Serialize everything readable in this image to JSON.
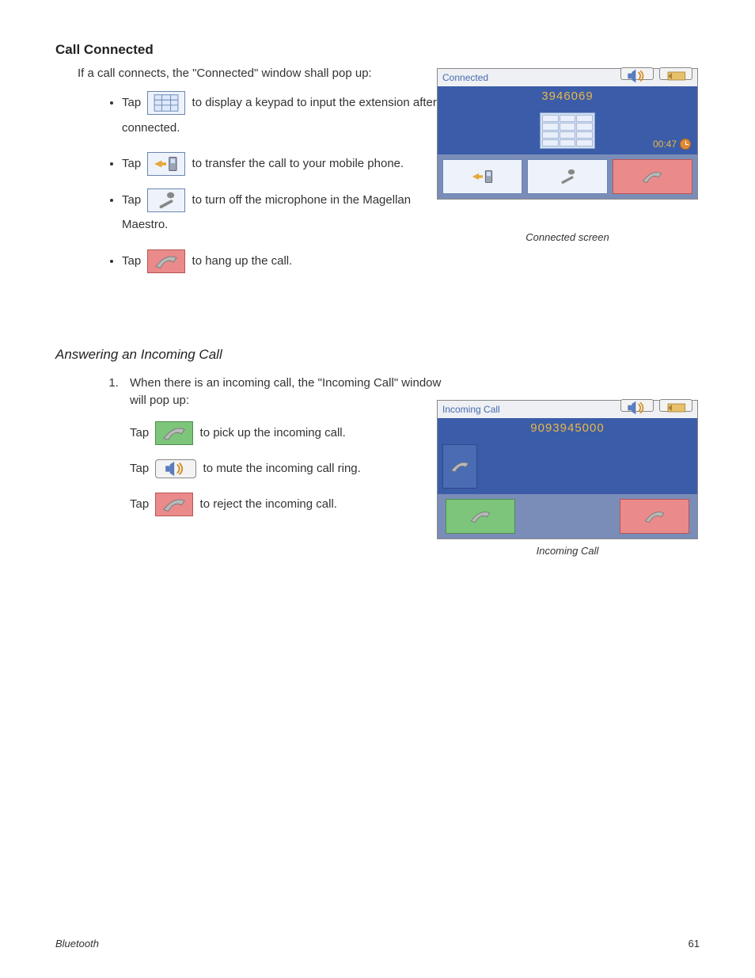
{
  "section1": {
    "title": "Call Connected",
    "intro": "If a call connects, the \"Connected\" window shall pop up:",
    "bullets": [
      {
        "pre": "Tap",
        "post": "to display a keypad to input the extension after connected."
      },
      {
        "pre": "Tap",
        "post": "to transfer the call to your mobile phone."
      },
      {
        "pre": "Tap",
        "post": "to turn off the microphone in the Magellan Maestro."
      },
      {
        "pre": "Tap",
        "post": "to hang up the call."
      }
    ],
    "screenshot": {
      "title": "Connected",
      "number": "3946069",
      "timer": "00:47",
      "caption": "Connected screen"
    }
  },
  "section2": {
    "title": "Answering an Incoming Call",
    "item1": "When there is an incoming call, the \"Incoming Call\" window will pop up:",
    "lines": [
      {
        "pre": "Tap",
        "post": "to pick up the incoming call."
      },
      {
        "pre": "Tap",
        "post": "to mute the incoming call ring."
      },
      {
        "pre": "Tap",
        "post": "to reject the incoming call."
      }
    ],
    "screenshot": {
      "title": "Incoming Call",
      "number": "9093945000",
      "caption": "Incoming Call"
    }
  },
  "footer": {
    "left": "Bluetooth",
    "right": "61"
  }
}
